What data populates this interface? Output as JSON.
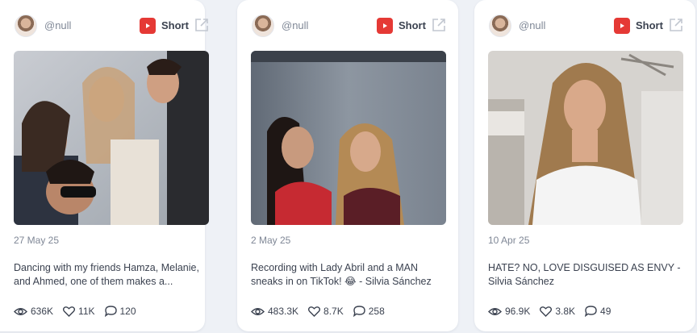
{
  "cards": [
    {
      "handle": "@null",
      "platform": "Short",
      "date": "27 May 25",
      "caption": "Dancing with my friends Hamza, Melanie, and Ahmed, one of them makes a...",
      "views": "636K",
      "likes": "11K",
      "comments": "120"
    },
    {
      "handle": "@null",
      "platform": "Short",
      "date": "2 May 25",
      "caption": "Recording with Lady Abril and a MAN sneaks in on TikTok! 😂 - Silvia Sánchez",
      "views": "483.3K",
      "likes": "8.7K",
      "comments": "258"
    },
    {
      "handle": "@null",
      "platform": "Short",
      "date": "10 Apr 25",
      "caption": "HATE? NO, LOVE DISGUISED AS ENVY - Silvia Sánchez",
      "views": "96.9K",
      "likes": "3.8K",
      "comments": "49"
    }
  ],
  "colors": {
    "background": "#eef1f6",
    "card": "#ffffff",
    "youtube_red": "#e53935",
    "muted_text": "#7f8796",
    "text": "#3b4250"
  },
  "icons": {
    "platform": "youtube-icon",
    "external": "external-link-icon",
    "views": "eye-icon",
    "likes": "heart-icon",
    "comments": "comment-icon"
  }
}
